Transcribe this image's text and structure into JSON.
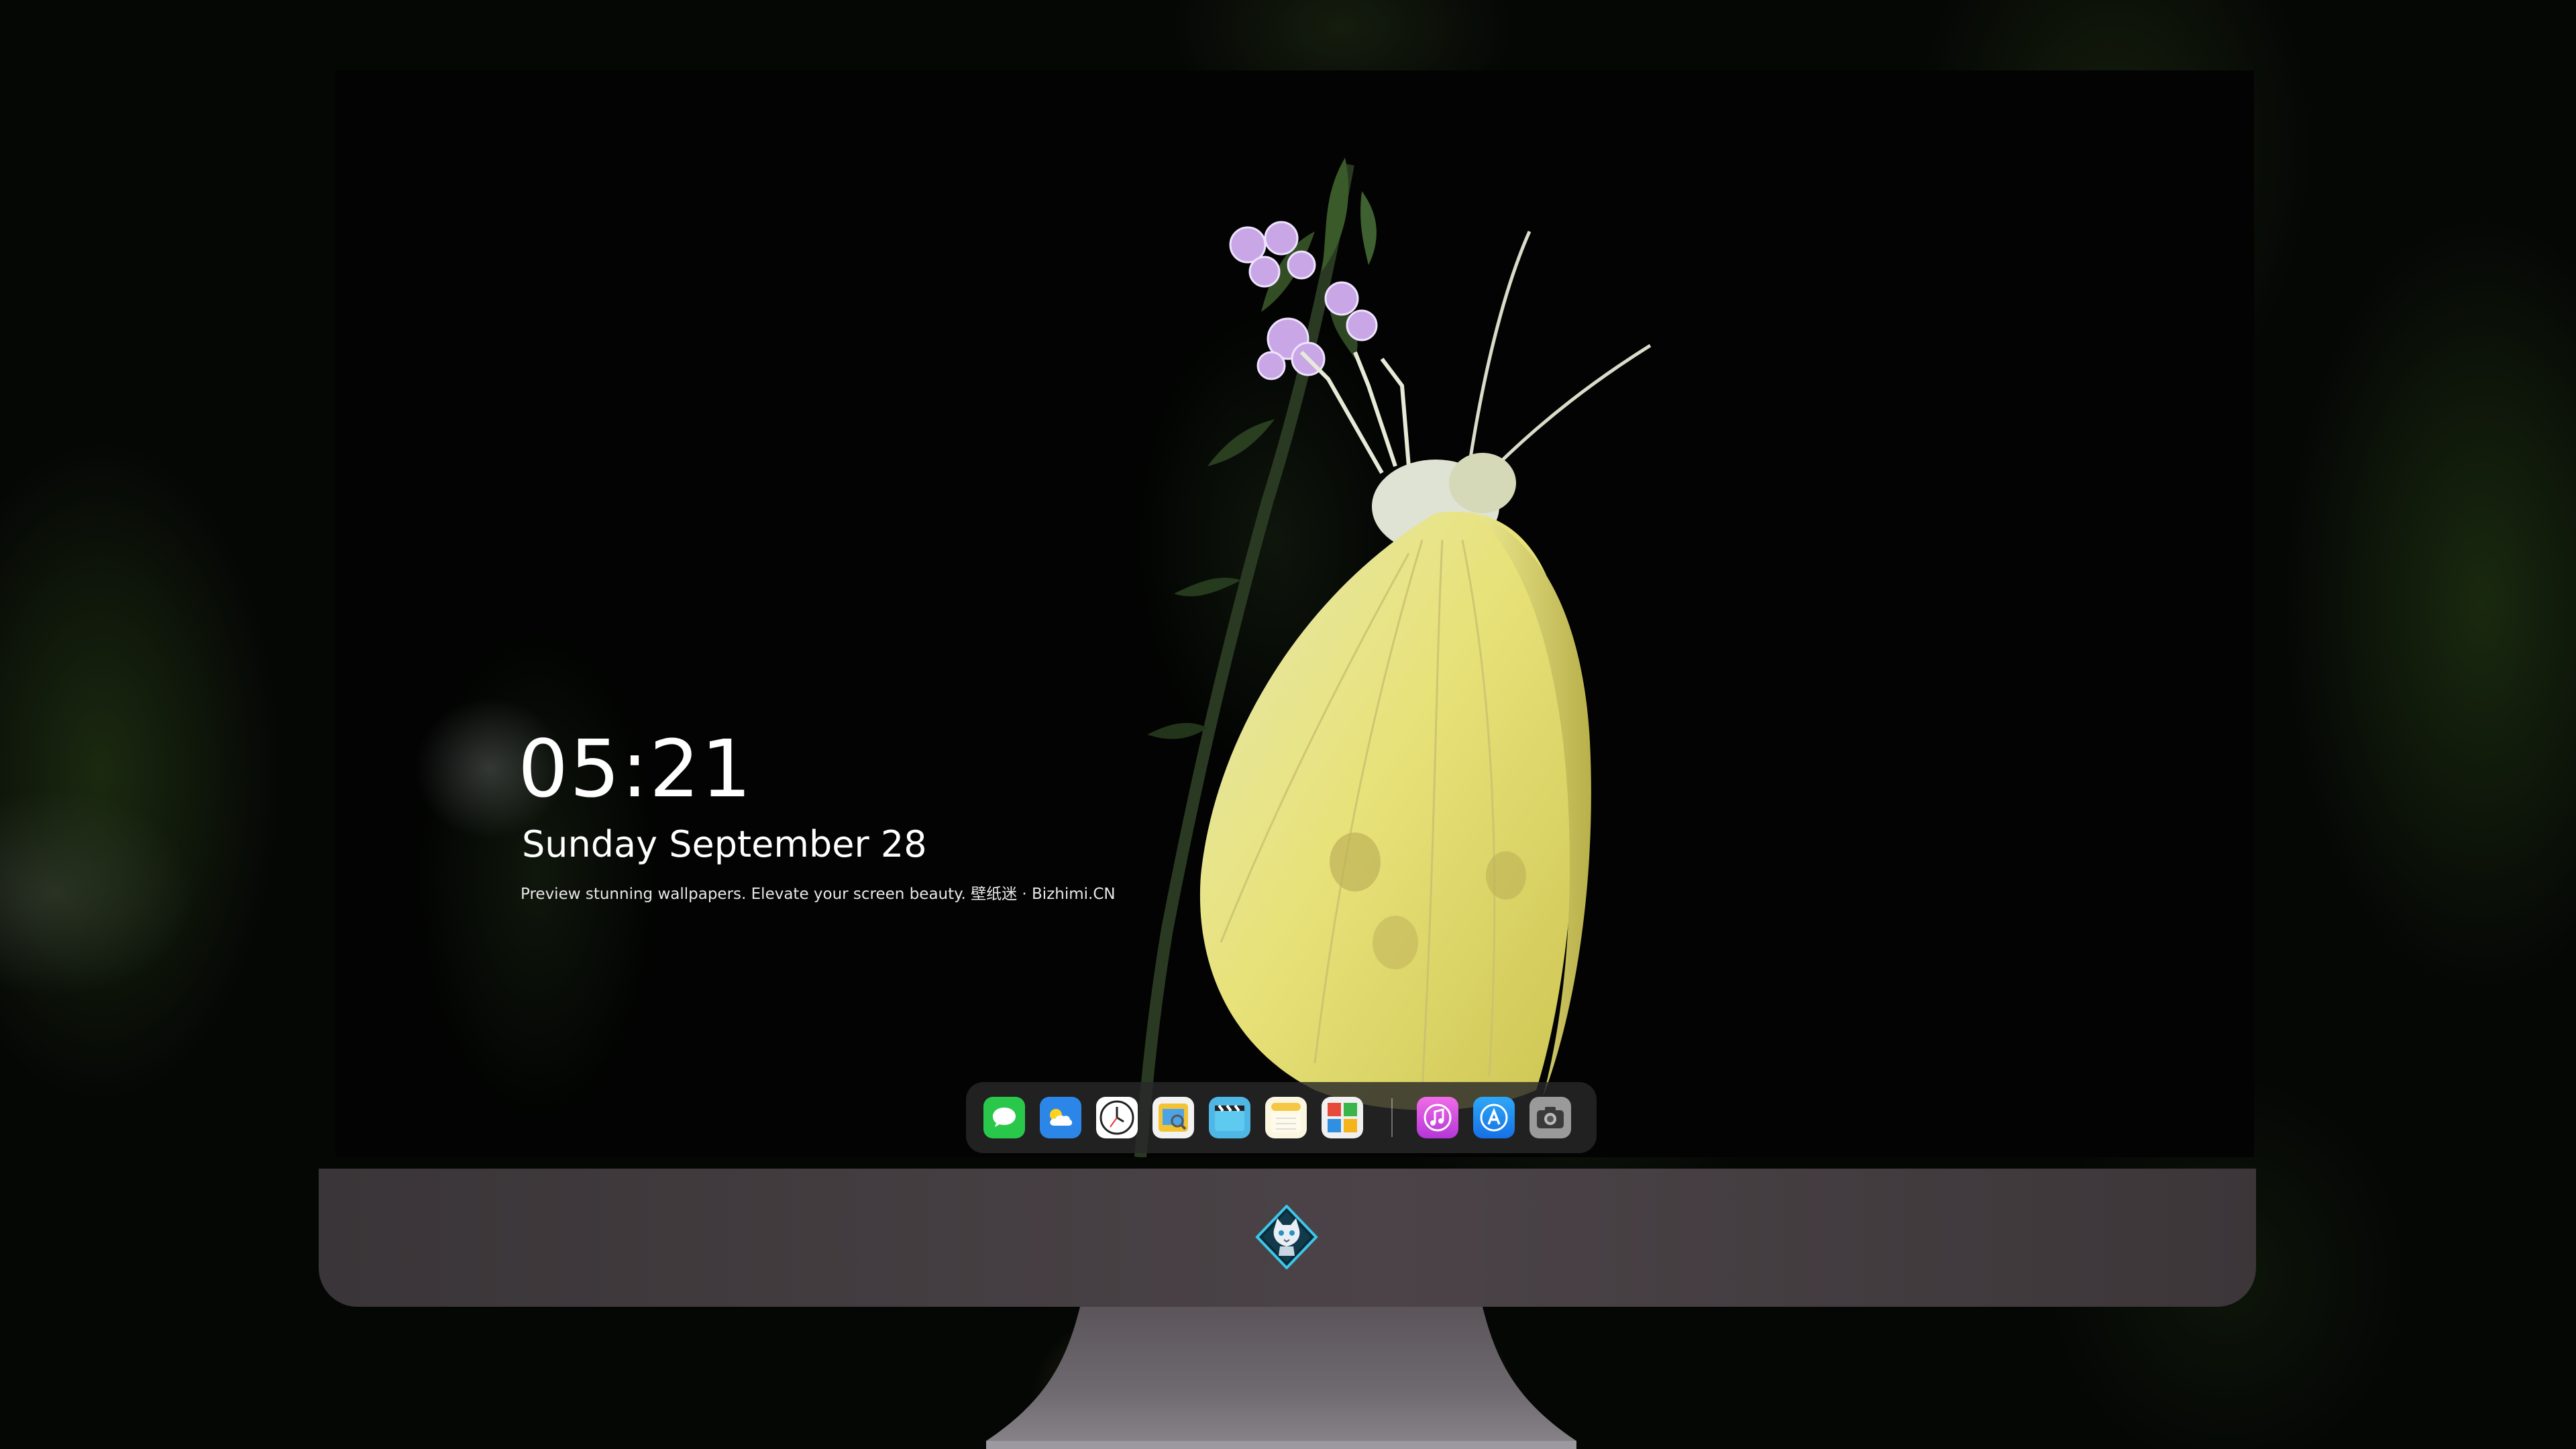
{
  "lock_screen": {
    "time": "05:21",
    "date": "Sunday September  28",
    "caption": "Preview stunning wallpapers. Elevate your screen beauty. 壁纸迷 · Bizhimi.CN"
  },
  "dock": {
    "apps": [
      {
        "name": "messages-icon",
        "glyph": "💬",
        "color": "#29c84a"
      },
      {
        "name": "weather-icon",
        "glyph": "⛅",
        "color": "#2b86e8"
      },
      {
        "name": "clock-icon",
        "glyph": "◷",
        "color": "#ffffff"
      },
      {
        "name": "preview-icon",
        "glyph": "▣",
        "color": "#f0c030"
      },
      {
        "name": "clips-icon",
        "glyph": "🎬",
        "color": "#4fb7e5"
      },
      {
        "name": "notes-icon",
        "glyph": "≡",
        "color": "#f6d55a"
      },
      {
        "name": "photo-booth-icon",
        "glyph": "▦",
        "color": "#e8e8e8"
      }
    ],
    "pinned": [
      {
        "name": "music-icon",
        "glyph": "♫",
        "color": "#d84be0"
      },
      {
        "name": "app-store-icon",
        "glyph": "A",
        "color": "#1c8ef0"
      },
      {
        "name": "camera-icon",
        "glyph": "◉",
        "color": "#8a8a8a"
      }
    ]
  }
}
